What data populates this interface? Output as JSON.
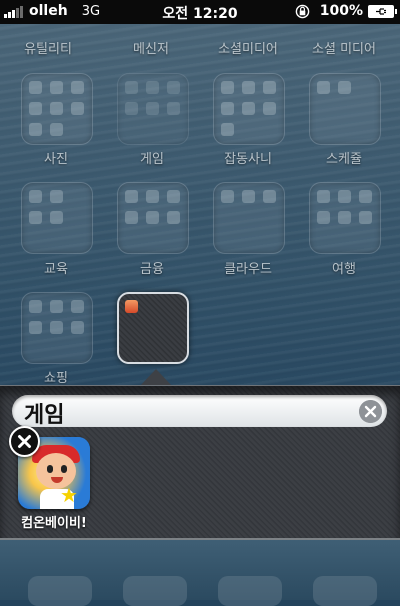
{
  "status_bar": {
    "carrier": "olleh",
    "network": "3G",
    "time": "오전 12:20",
    "battery": "100%"
  },
  "home": {
    "top_row": [
      "유틸리티",
      "메신저",
      "소셜미디어",
      "소셜 미디어"
    ],
    "folders_row1": [
      "사진",
      "게임",
      "잡동사니",
      "스케쥴"
    ],
    "folders_row2": [
      "교육",
      "금융",
      "클라우드",
      "여행"
    ],
    "folders_row3": [
      "쇼핑"
    ]
  },
  "open_folder": {
    "name": "게임",
    "apps": [
      {
        "label": "컴온베이비!"
      }
    ]
  }
}
